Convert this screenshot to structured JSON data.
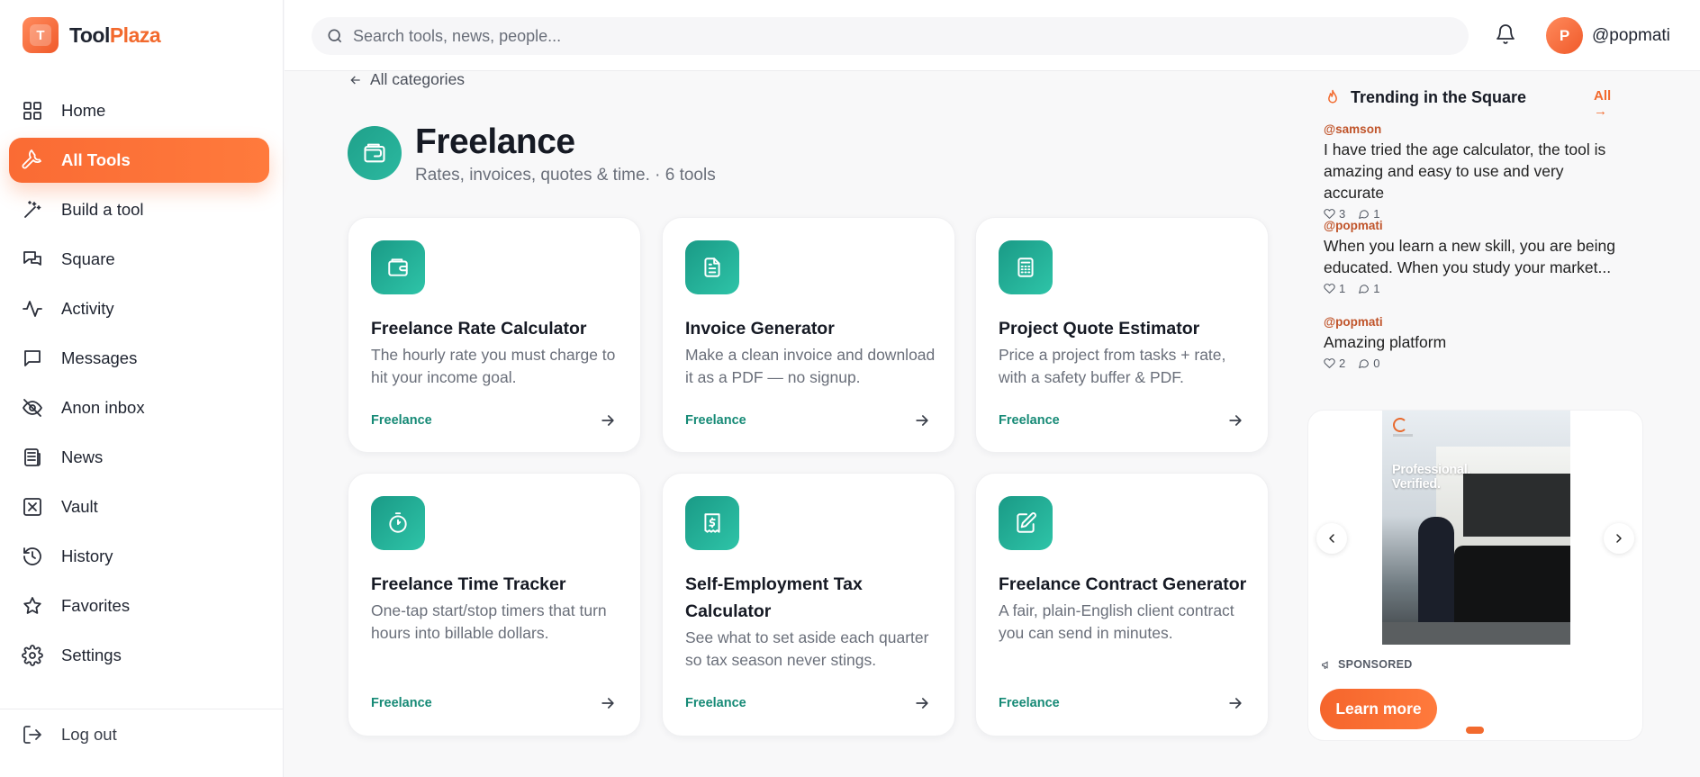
{
  "brand": {
    "letter": "T",
    "name_part1": "Tool",
    "name_part2": "Plaza"
  },
  "search": {
    "placeholder": "Search tools, news, people..."
  },
  "user": {
    "initial": "P",
    "handle": "@popmati"
  },
  "nav": [
    {
      "label": "Home",
      "icon": "home-grid-icon"
    },
    {
      "label": "All Tools",
      "icon": "wrench-icon",
      "active": true
    },
    {
      "label": "Build a tool",
      "icon": "magic-wand-icon"
    },
    {
      "label": "Square",
      "icon": "chat-bubbles-icon"
    },
    {
      "label": "Activity",
      "icon": "activity-pulse-icon"
    },
    {
      "label": "Messages",
      "icon": "message-icon"
    },
    {
      "label": "Anon inbox",
      "icon": "eye-off-icon"
    },
    {
      "label": "News",
      "icon": "newspaper-icon"
    },
    {
      "label": "Vault",
      "icon": "vault-x-icon"
    },
    {
      "label": "History",
      "icon": "history-icon"
    },
    {
      "label": "Favorites",
      "icon": "star-icon"
    },
    {
      "label": "Settings",
      "icon": "gear-icon"
    }
  ],
  "logout_label": "Log out",
  "back_label": "All categories",
  "page": {
    "title": "Freelance",
    "subtitle": "Rates, invoices, quotes & time. · 6 tools"
  },
  "tools": [
    {
      "title": "Freelance Rate Calculator",
      "desc": "The hourly rate you must charge to hit your income goal.",
      "tag": "Freelance",
      "icon": "wallet-icon"
    },
    {
      "title": "Invoice Generator",
      "desc": "Make a clean invoice and download it as a PDF — no signup.",
      "tag": "Freelance",
      "icon": "document-icon"
    },
    {
      "title": "Project Quote Estimator",
      "desc": "Price a project from tasks + rate, with a safety buffer & PDF.",
      "tag": "Freelance",
      "icon": "calculator-icon"
    },
    {
      "title": "Freelance Time Tracker",
      "desc": "One-tap start/stop timers that turn hours into billable dollars.",
      "tag": "Freelance",
      "icon": "timer-icon"
    },
    {
      "title": "Self-Employment Tax Calculator",
      "desc": "See what to set aside each quarter so tax season never stings.",
      "tag": "Freelance",
      "icon": "receipt-dollar-icon"
    },
    {
      "title": "Freelance Contract Generator",
      "desc": "A fair, plain-English client contract you can send in minutes.",
      "tag": "Freelance",
      "icon": "contract-edit-icon"
    }
  ],
  "trending": {
    "title": "Trending in the Square",
    "all_label": "All",
    "posts": [
      {
        "handle": "@samson",
        "body": "I have tried the age calculator, the tool is amazing and easy to use and very accurate",
        "likes": "3",
        "comments": "1"
      },
      {
        "handle": "@popmati",
        "body": "When you learn a new skill, you are being educated. When you study your market...",
        "likes": "1",
        "comments": "1"
      },
      {
        "handle": "@popmati",
        "body": "Amazing platform",
        "likes": "2",
        "comments": "0"
      }
    ]
  },
  "ad": {
    "caption_line1": "Professional.",
    "caption_line2": "Verified.",
    "sponsored_label": "SPONSORED",
    "cta_label": "Learn more"
  },
  "colors": {
    "accent": "#f26a2e",
    "teal": "#1fa08a"
  }
}
